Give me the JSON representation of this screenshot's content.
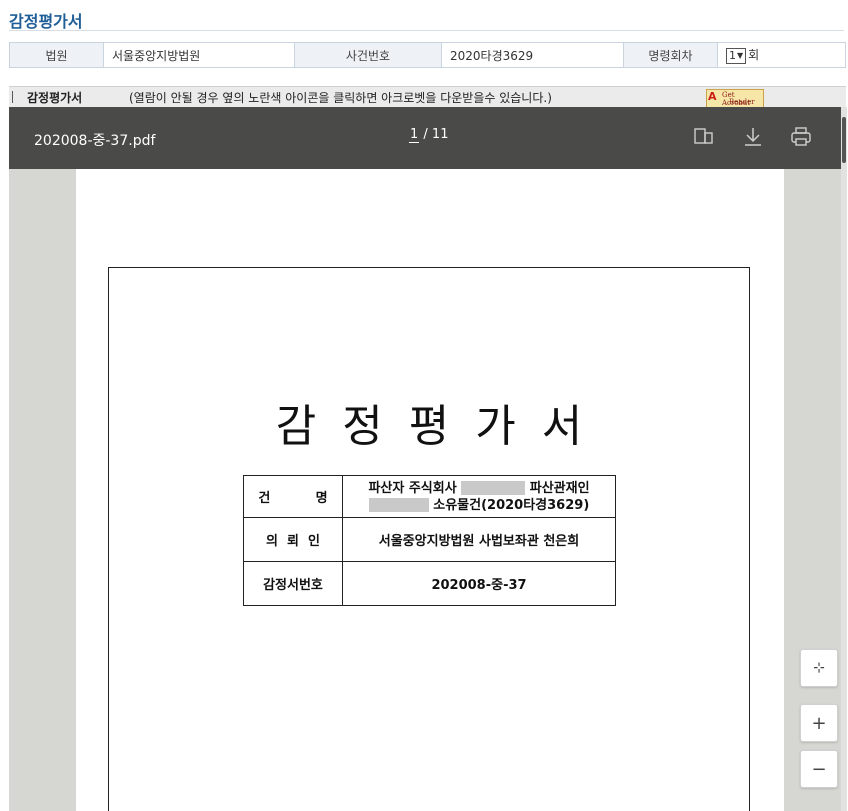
{
  "page_title": "감정평가서",
  "info": {
    "court_label": "법원",
    "court_value": "서울중앙지방법원",
    "case_label": "사건번호",
    "case_value": "2020타경3629",
    "order_label": "명령회차",
    "order_select": "1",
    "order_suffix": "회"
  },
  "bar": {
    "label": "감정평가서",
    "message": "(열람이 안될 경우 옆의 노란색 아이콘을 클릭하면 아크로벳을 다운받을수 있습니다.)",
    "acrobat_line1": "Get Acrobat",
    "acrobat_line2": "Reader",
    "acrobat_adobe": "Adobe"
  },
  "viewer": {
    "file_name": "202008-중-37.pdf",
    "page_current": "1",
    "page_total": "/ 11",
    "icons": [
      "two-page-view-icon",
      "download-icon",
      "print-icon"
    ]
  },
  "document": {
    "title": "감정평가서",
    "rows": [
      {
        "key": "건          명",
        "value_a": "파산자 주식회사",
        "value_b": "파산관재인",
        "value_c": "소유물건(2020타경3629)"
      },
      {
        "key": "의  뢰  인",
        "value": "서울중앙지방법원 사법보좌관 천은희"
      },
      {
        "key": "감정서번호",
        "value": "202008-중-37"
      }
    ]
  },
  "controls": {
    "fit_symbol": "⊹",
    "zoom_in": "+",
    "zoom_out": "−"
  }
}
